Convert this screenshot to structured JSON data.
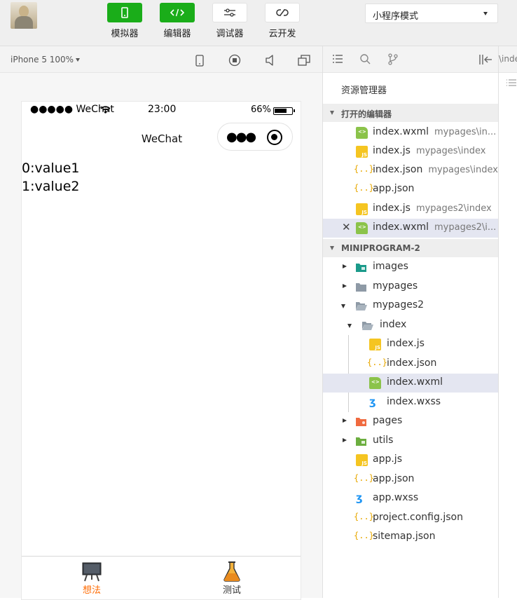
{
  "toolbar": {
    "simulator": "模拟器",
    "editor": "编辑器",
    "debugger": "调试器",
    "cloud": "云开发",
    "mode": "小程序模式"
  },
  "simulator": {
    "device": "iPhone 5 100%",
    "status_left": "●●●●● WeChat",
    "status_time": "23:00",
    "status_battery": "66%",
    "nav_title": "WeChat",
    "content": [
      "0:value1",
      "1:value2"
    ],
    "tabs": [
      {
        "label": "想法",
        "color": "#ff6a00"
      },
      {
        "label": "测试",
        "color": "#333333"
      }
    ]
  },
  "explorer": {
    "title": "资源管理器",
    "open_section": "打开的编辑器",
    "project_section": "MINIPROGRAM-2",
    "open_editors": [
      {
        "name": "index.wxml",
        "path": "mypages\\in...",
        "type": "wxml"
      },
      {
        "name": "index.js",
        "path": "mypages\\index",
        "type": "js"
      },
      {
        "name": "index.json",
        "path": "mypages\\index",
        "type": "json"
      },
      {
        "name": "app.json",
        "path": "",
        "type": "json"
      },
      {
        "name": "index.js",
        "path": "mypages2\\index",
        "type": "js"
      },
      {
        "name": "index.wxml",
        "path": "mypages2\\i...",
        "type": "wxml"
      }
    ],
    "tree": [
      {
        "name": "images"
      },
      {
        "name": "mypages"
      },
      {
        "name": "mypages2"
      },
      {
        "name": "index"
      },
      {
        "name": "index.js"
      },
      {
        "name": "index.json"
      },
      {
        "name": "index.wxml"
      },
      {
        "name": "index.wxss"
      },
      {
        "name": "pages"
      },
      {
        "name": "utils"
      },
      {
        "name": "app.js"
      },
      {
        "name": "app.json"
      },
      {
        "name": "app.wxss"
      },
      {
        "name": "project.config.json"
      },
      {
        "name": "sitemap.json"
      }
    ]
  },
  "editor": {
    "tab": "\\inde"
  }
}
